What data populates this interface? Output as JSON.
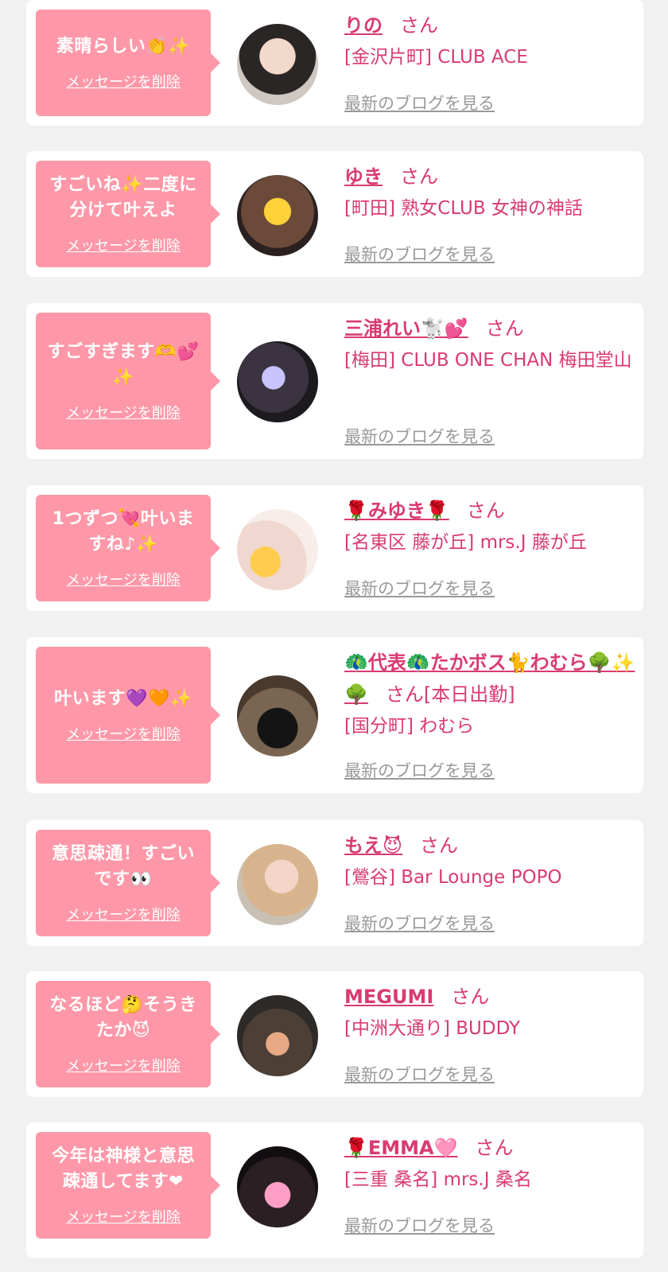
{
  "delete_label": "メッセージを削除",
  "blog_label": "最新のブログを見る",
  "san_label": "さん",
  "cards": [
    {
      "message": "素晴らしい👏✨",
      "name": "りの",
      "shop": "[金沢片町] CLUB ACE"
    },
    {
      "message": "すごいね✨二度に分けて叶えよ",
      "name": "ゆき",
      "shop": "[町田] 熟女CLUB 女神の神話"
    },
    {
      "message": "すごすぎます🫶💕✨",
      "name": "三浦れい🐩💕",
      "shop": "[梅田] CLUB ONE CHAN 梅田堂山"
    },
    {
      "message": "1つずつ💘叶いますね♪✨",
      "name": "🌹みゆき🌹",
      "shop": "[名東区 藤が丘] mrs.J 藤が丘"
    },
    {
      "message": "叶います💜🧡✨",
      "name": "🦚代表🦚たかボス🐈わむら🌳✨🌳",
      "status": "[本日出勤]",
      "shop": "[国分町] わむら"
    },
    {
      "message": "意思疎通！すごいです👀",
      "name": "もえ😈",
      "shop": "[鶯谷] Bar Lounge POPO"
    },
    {
      "message": "なるほど🤔そうきたか😈",
      "name": "MEGUMI",
      "shop": "[中洲大通り] BUDDY"
    },
    {
      "message": "今年は神様と意思疎通してます❤",
      "name": "🌹EMMA🩷",
      "shop": "[三重 桑名] mrs.J 桑名"
    }
  ],
  "colors": {
    "bubble": "#fe98a8",
    "accent": "#d93a72",
    "link_gray": "#999999",
    "background": "#f1f1f1"
  }
}
